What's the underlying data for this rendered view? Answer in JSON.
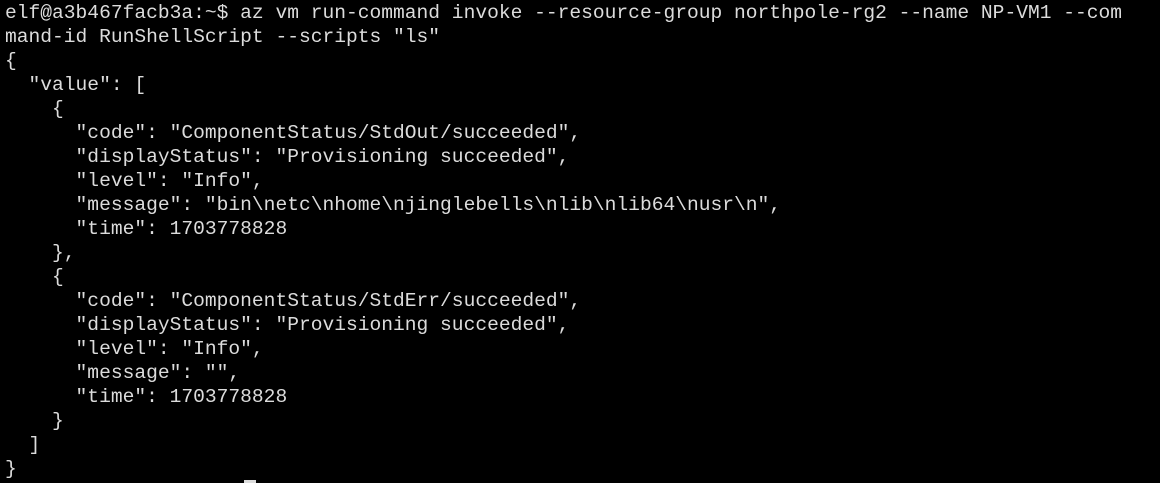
{
  "terminal": {
    "colors": {
      "background": "#000000",
      "foreground": "#dcdcdc"
    },
    "lines": [
      "elf@a3b467facb3a:~$ az vm run-command invoke --resource-group northpole-rg2 --name NP-VM1 --com",
      "mand-id RunShellScript --scripts \"ls\"",
      "{",
      "  \"value\": [",
      "    {",
      "      \"code\": \"ComponentStatus/StdOut/succeeded\",",
      "      \"displayStatus\": \"Provisioning succeeded\",",
      "      \"level\": \"Info\",",
      "      \"message\": \"bin\\netc\\nhome\\njinglebells\\nlib\\nlib64\\nusr\\n\",",
      "      \"time\": 1703778828",
      "    },",
      "    {",
      "      \"code\": \"ComponentStatus/StdErr/succeeded\",",
      "      \"displayStatus\": \"Provisioning succeeded\",",
      "      \"level\": \"Info\",",
      "      \"message\": \"\",",
      "      \"time\": 1703778828",
      "    }",
      "  ]",
      "}"
    ]
  }
}
